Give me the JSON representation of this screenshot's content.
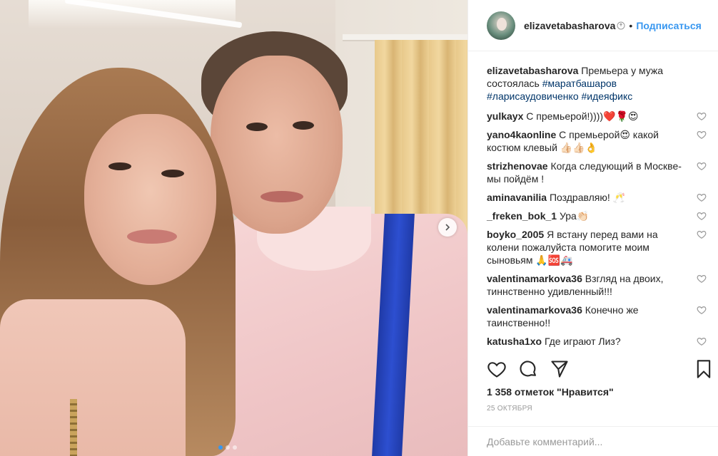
{
  "post": {
    "username": "elizavetabasharova",
    "follow_label": "Подписаться",
    "separator": "•",
    "caption": {
      "user": "elizavetabasharova",
      "text": "Премьера у мужа состоялась",
      "tags": [
        "#маратбашаров",
        "#ларисаудовиченко",
        "#идеяфикс"
      ]
    },
    "comments": [
      {
        "user": "yulkayx",
        "text": "С премьерой!))))❤️🌹😍"
      },
      {
        "user": "yano4kaonline",
        "text": "С премьерой😍 какой костюм клевый 👍🏻👍🏻👌"
      },
      {
        "user": "strizhenovae",
        "text": "Когда следующий в Москве-мы пойдём !"
      },
      {
        "user": "aminavanilia",
        "text": "Поздравляю! 🥂"
      },
      {
        "user": "_freken_bok_1",
        "text": "Ура👏🏻"
      },
      {
        "user": "boyko_2005",
        "text": "Я встану перед вами на колени пожалуйста помогите моим сыновьям 🙏🆘🚑"
      },
      {
        "user": "valentinamarkova36",
        "text": "Взгляд на двоих, тиннственно удивленный!!!"
      },
      {
        "user": "valentinamarkova36",
        "text": "Конечно же таинственно!!"
      },
      {
        "user": "katusha1xo",
        "text": "Где играют Лиз?"
      }
    ],
    "likes_text": "1 358 отметок \"Нравится\"",
    "date": "25 октября",
    "add_comment_placeholder": "Добавьте комментарий...",
    "carousel": {
      "count": 3,
      "active": 0
    },
    "colors": {
      "accent": "#3897f0",
      "hashtag": "#003569",
      "muted": "#999999"
    },
    "icons": [
      "verified-icon",
      "heart-icon",
      "comment-icon",
      "share-icon",
      "bookmark-icon",
      "chevron-right-icon"
    ]
  }
}
